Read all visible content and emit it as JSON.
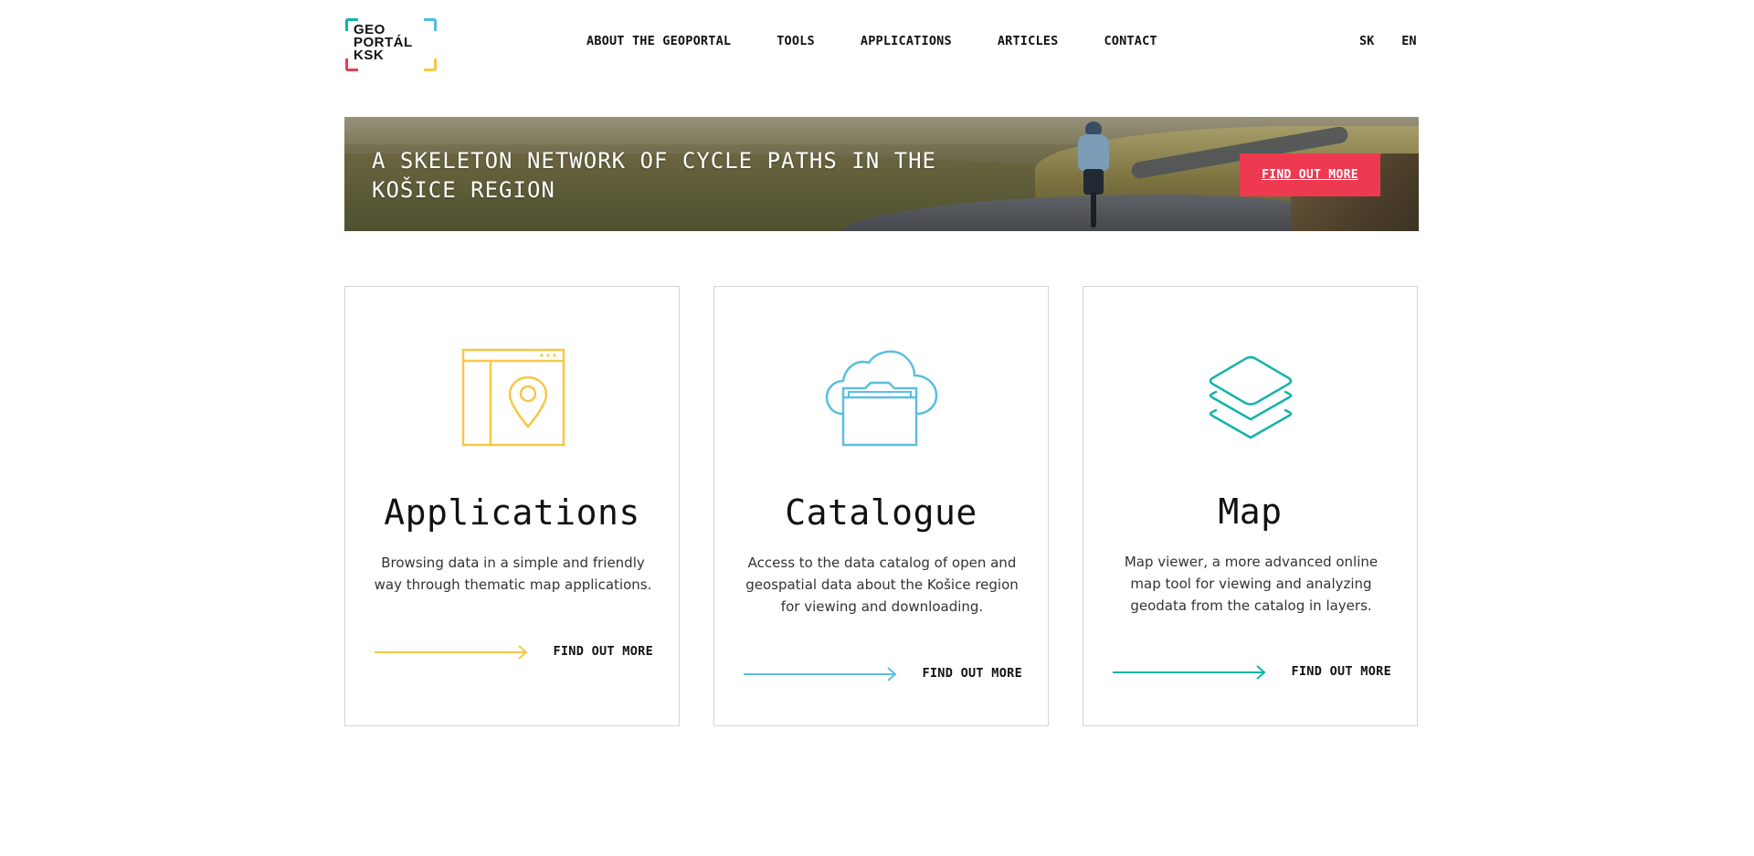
{
  "header": {
    "logo_lines": [
      "GEO",
      "PORTÁL",
      "KSK"
    ],
    "nav": [
      {
        "label": "ABOUT THE GEOPORTAL"
      },
      {
        "label": "TOOLS"
      },
      {
        "label": "APPLICATIONS"
      },
      {
        "label": "ARTICLES"
      },
      {
        "label": "CONTACT"
      }
    ],
    "languages": [
      {
        "label": "SK"
      },
      {
        "label": "EN"
      }
    ]
  },
  "banner": {
    "title": "A SKELETON NETWORK OF CYCLE PATHS IN THE KOŠICE REGION",
    "button_label": "FIND OUT MORE"
  },
  "cards": [
    {
      "title": "Applications",
      "description": "Browsing data in a simple and friendly way through thematic map applications.",
      "link_label": "FIND OUT MORE",
      "icon": "map-app-icon",
      "accent": "#f7c844"
    },
    {
      "title": "Catalogue",
      "description": "Access to the data catalog of open and geospatial data about the Košice region for viewing and downloading.",
      "link_label": "FIND OUT MORE",
      "icon": "cloud-folder-icon",
      "accent": "#5bbfe0"
    },
    {
      "title": "Map",
      "description": "Map viewer, a more advanced online map tool for viewing and analyzing geodata from the catalog in layers.",
      "link_label": "FIND OUT MORE",
      "icon": "layers-icon",
      "accent": "#14b3a8"
    }
  ],
  "colors": {
    "accent_red": "#ee3a51",
    "logo_teal": "#14b3a8",
    "logo_blue": "#4fbfe0",
    "logo_yellow": "#f7c844"
  }
}
